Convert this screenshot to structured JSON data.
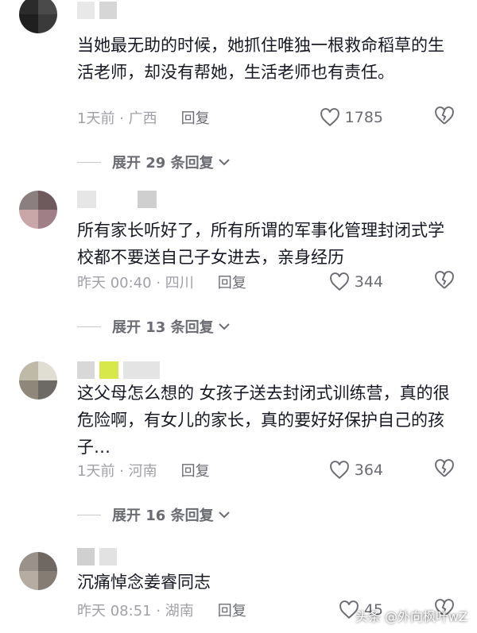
{
  "comments": [
    {
      "text": "当她最无助的时候，她抓住唯独一根救命稻草的生活老师，却没有帮她，生活老师也有责任。",
      "time_location": "1天前 · 广西",
      "reply_label": "回复",
      "likes": "1785",
      "expand_label": "展开 29 条回复",
      "avatar_colors": [
        "#2b2b2b",
        "#4a4a4a",
        "#1f1f1f",
        "#3a3a3a"
      ],
      "name_colors": [
        "#e8e8e8",
        "#d6d6d6"
      ]
    },
    {
      "text": "所有家长听好了，所有所谓的军事化管理封闭式学校都不要送自己子女进去，亲身经历",
      "time_location": "昨天 00:40 · 四川",
      "reply_label": "回复",
      "likes": "344",
      "expand_label": "展开 13 条回复",
      "avatar_colors": [
        "#8c7f80",
        "#6e5a5c",
        "#c9a6a8",
        "#a07f86"
      ],
      "name_colors": [
        "#e6e6e6",
        "#cfcfcf",
        "#bdbdbd"
      ]
    },
    {
      "text": "这父母怎么想的 女孩子送去封闭式训练营，真的很危险啊，有女儿的家长，真的要好好保护自己的孩子…",
      "time_location": "1天前 · 河南",
      "reply_label": "回复",
      "likes": "364",
      "expand_label": "展开 16 条回复",
      "avatar_colors": [
        "#bfb9a8",
        "#e0ddd2",
        "#8f877a",
        "#6d6a66"
      ],
      "name_colors": [
        "#d8d8d8",
        "#d6e84a",
        "#e4e4e4"
      ]
    },
    {
      "text": "沉痛悼念姜睿同志",
      "time_location": "昨天 08:51 · 湖南",
      "reply_label": "回复",
      "likes": "45",
      "avatar_colors": [
        "#9a928a",
        "#6f6862",
        "#b7aca2",
        "#857c74"
      ],
      "name_colors": [
        "#d0d0d0",
        "#e2e2e2"
      ]
    }
  ],
  "watermark": "头条 @外向枫叶wZ"
}
